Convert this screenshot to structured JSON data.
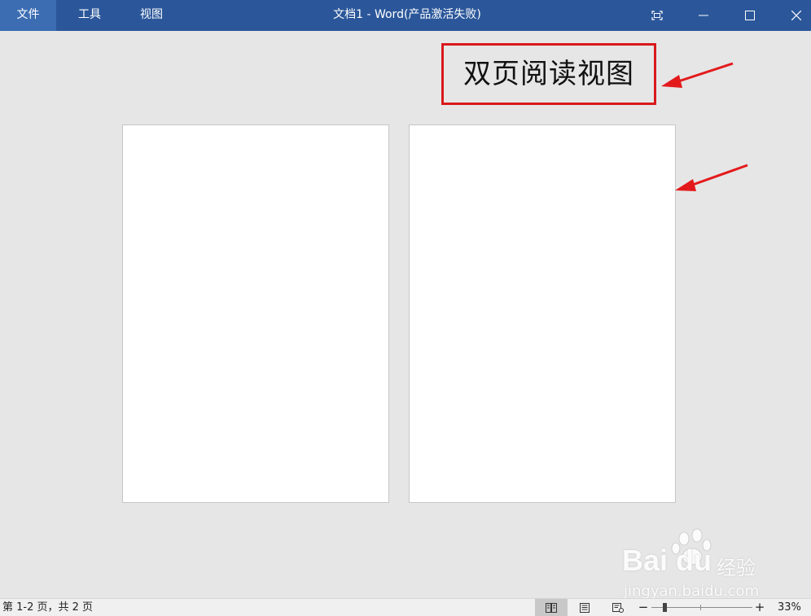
{
  "menu": {
    "file": "文件",
    "tools": "工具",
    "view": "视图"
  },
  "window": {
    "title": "文档1 - Word(产品激活失败)"
  },
  "annotation": {
    "label": "双页阅读视图",
    "accent": "#d9191c"
  },
  "statusbar": {
    "page_info": "第 1-2 页，共 2 页",
    "zoom_minus": "−",
    "zoom_plus": "+",
    "zoom_level": "33%",
    "zoom_fraction": 0.33
  },
  "watermark": {
    "brand": "Bai du",
    "brand_cn": "经验",
    "url": "jingyan.baidu.com"
  },
  "colors": {
    "titlebar": "#2b579a",
    "workspace": "#e6e6e6",
    "page": "#ffffff"
  }
}
